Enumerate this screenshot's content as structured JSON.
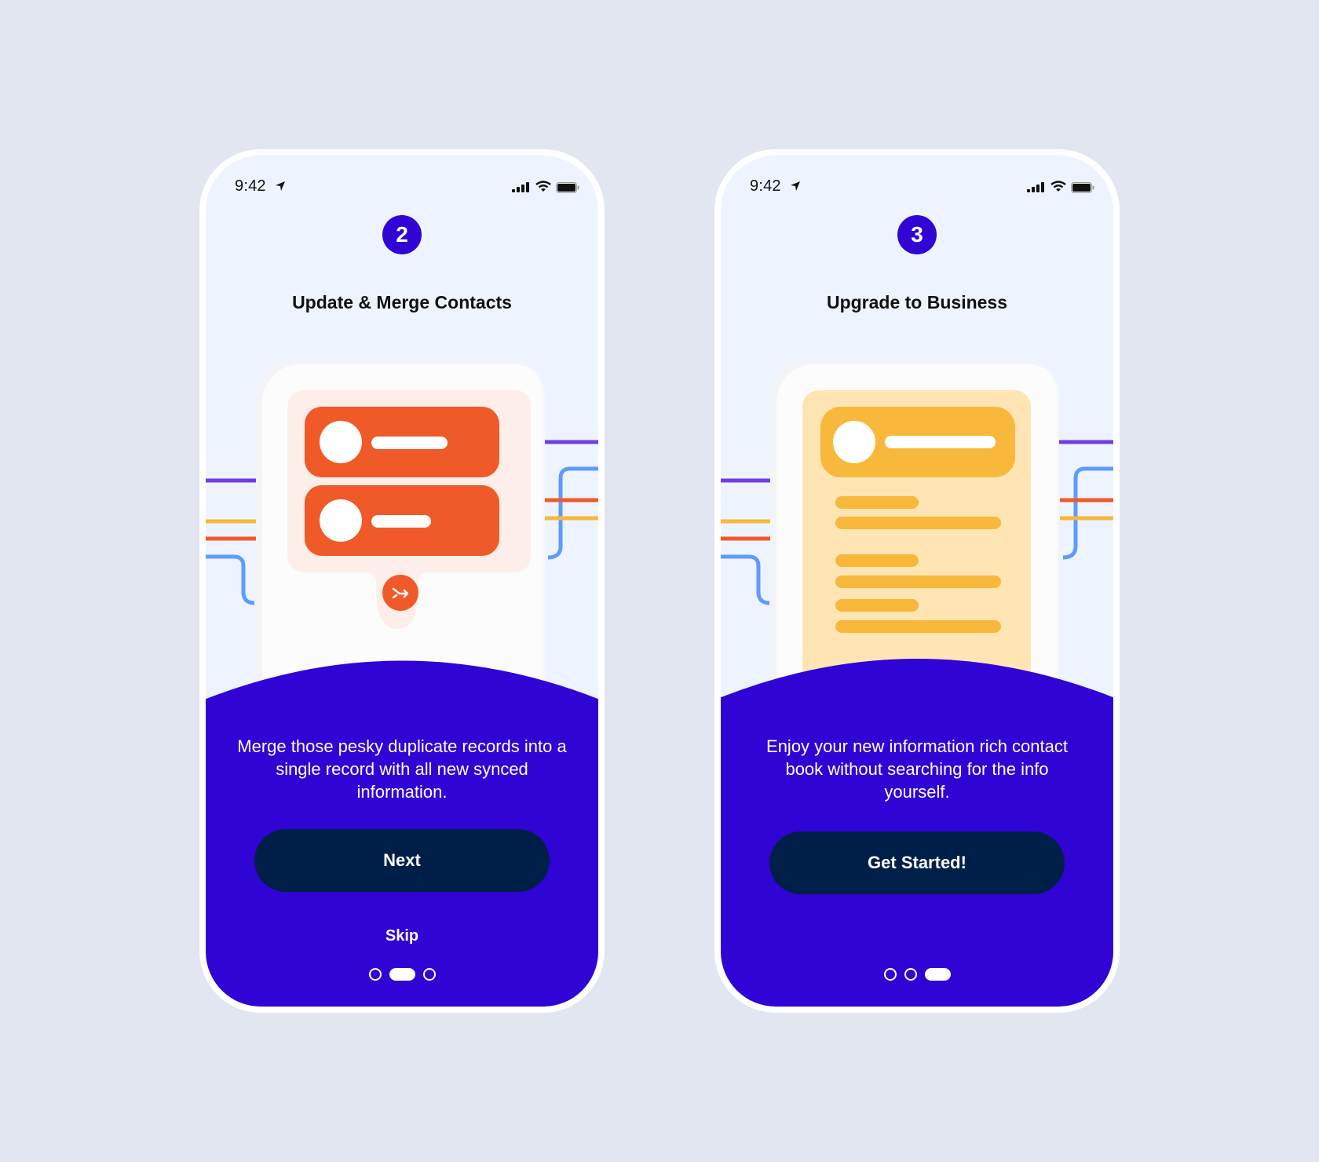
{
  "colors": {
    "background": "#e1e6f0",
    "screen": "#eef4ff",
    "brand_purple": "#3004d4",
    "button_navy": "#001f48",
    "orange": "#ef5a28",
    "orange_tint": "#fdeeea",
    "yellow": "#f7b83b",
    "yellow_tint": "#ffe5b4",
    "line_purple": "#6e3fe0",
    "line_blue": "#5c9cff"
  },
  "screens": [
    {
      "status_bar": {
        "time": "9:42",
        "icons": [
          "location-arrow-icon",
          "signal-icon",
          "wifi-icon",
          "battery-icon"
        ]
      },
      "step_number": "2",
      "title": "Update & Merge Contacts",
      "illustration": "merge-contacts-illustration",
      "description": "Merge those pesky duplicate records into a single record with all new synced information.",
      "primary_button": "Next",
      "secondary_link": "Skip",
      "pagination": {
        "total": 3,
        "active": 2
      }
    },
    {
      "status_bar": {
        "time": "9:42",
        "icons": [
          "location-arrow-icon",
          "signal-icon",
          "wifi-icon",
          "battery-icon"
        ]
      },
      "step_number": "3",
      "title": "Upgrade to Business",
      "illustration": "business-contact-card-illustration",
      "description": "Enjoy your new information rich contact book without searching for the info yourself.",
      "primary_button": "Get Started!",
      "pagination": {
        "total": 3,
        "active": 3
      }
    }
  ]
}
